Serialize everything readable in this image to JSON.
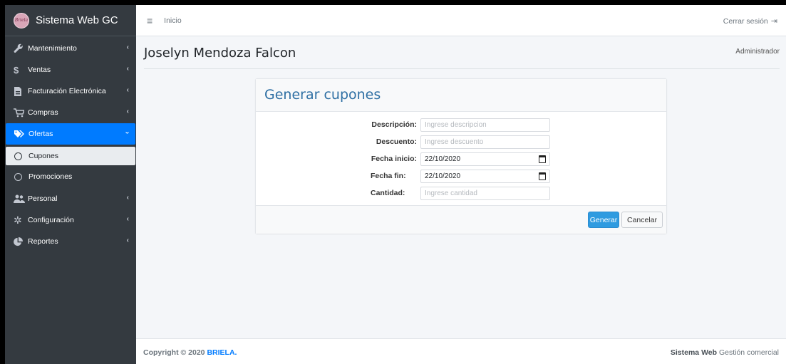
{
  "brand": {
    "title": "Sistema Web GC",
    "logo_text": "Briela"
  },
  "sidebar": {
    "items": [
      {
        "label": "Mantenimiento",
        "icon": "wrench-icon"
      },
      {
        "label": "Ventas",
        "icon": "dollar-icon"
      },
      {
        "label": "Facturación Electrónica",
        "icon": "file-invoice-icon"
      },
      {
        "label": "Compras",
        "icon": "cart-icon"
      },
      {
        "label": "Ofertas",
        "icon": "tags-icon",
        "active": true
      },
      {
        "label": "Personal",
        "icon": "users-icon"
      },
      {
        "label": "Configuración",
        "icon": "gear-icon"
      },
      {
        "label": "Reportes",
        "icon": "pie-chart-icon"
      }
    ],
    "subitems": [
      {
        "label": "Cupones",
        "selected": true
      },
      {
        "label": "Promociones"
      }
    ]
  },
  "topbar": {
    "home_label": "Inicio",
    "logout_label": "Cerrar sesión"
  },
  "header": {
    "user_name": "Joselyn Mendoza Falcon",
    "role": "Administrador"
  },
  "card": {
    "title": "Generar cupones",
    "fields": {
      "descripcion": {
        "label": "Descripción:",
        "placeholder": "Ingrese descripcion"
      },
      "descuento": {
        "label": "Descuento:",
        "placeholder": "Ingrese descuento"
      },
      "fecha_inicio": {
        "label": "Fecha inicio:",
        "value": "22/10/2020"
      },
      "fecha_fin": {
        "label": "Fecha fin:",
        "value": "22/10/2020"
      },
      "cantidad": {
        "label": "Cantidad:",
        "placeholder": "Ingrese cantidad"
      }
    },
    "buttons": {
      "submit": "Generar",
      "cancel": "Cancelar"
    }
  },
  "footer": {
    "copyright_prefix": "Copyright © 2020 ",
    "copyright_brand": "BRIELA.",
    "system_bold": "Sistema Web",
    "system_rest": " Gestión comercial"
  },
  "colors": {
    "sidebar_bg": "#343a40",
    "active": "#007bff",
    "title": "#2e6fa3",
    "button": "#2f9be0"
  }
}
